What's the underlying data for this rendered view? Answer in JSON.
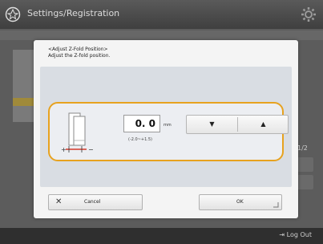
{
  "header": {
    "title": "Settings/Registration",
    "logo_icon": "home-logo-icon",
    "settings_icon": "gear-icon"
  },
  "background": {
    "page_indicator": "1/2"
  },
  "footer": {
    "logout_label": "Log Out"
  },
  "dialog": {
    "title_line1": "<Adjust Z-Fold Position>",
    "title_line2": "Adjust the Z-fold position.",
    "value": "0. 0",
    "unit": "mm",
    "range": "(-2.0~+1.5)",
    "plus_label": "+",
    "minus_label": "−",
    "down_arrow": "▼",
    "up_arrow": "▲",
    "cancel_icon": "✕",
    "cancel_label": "Cancel",
    "ok_label": "OK"
  },
  "colors": {
    "accent": "#e7a21f",
    "indicator_red": "#d43a2a"
  }
}
